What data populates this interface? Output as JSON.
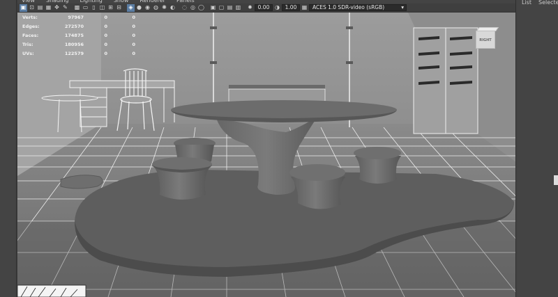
{
  "app": {
    "panel_menu": [
      "View",
      "Shading",
      "Lighting",
      "Show",
      "Renderer",
      "Panels"
    ],
    "right_panel_tabs": [
      "List",
      "Selected"
    ]
  },
  "toolbar": {
    "exposure_value": "0.00",
    "gamma_value": "1.00",
    "color_space": "ACES 1.0 SDR-video (sRGB)"
  },
  "hud": {
    "rows": [
      {
        "label": "Verts:",
        "v1": "97967",
        "v2": "0",
        "v3": "0"
      },
      {
        "label": "Edges:",
        "v1": "272570",
        "v2": "0",
        "v3": "0"
      },
      {
        "label": "Faces:",
        "v1": "174875",
        "v2": "0",
        "v3": "0"
      },
      {
        "label": "Tris:",
        "v1": "180956",
        "v2": "0",
        "v3": "0"
      },
      {
        "label": "UVs:",
        "v1": "122579",
        "v2": "0",
        "v3": "0"
      }
    ]
  },
  "viewcube": {
    "face_label": "RIGHT"
  },
  "colors": {
    "active_tool": "#5b7da3",
    "viewport_bg": "#9a9a9a",
    "ui_dark": "#444444"
  }
}
